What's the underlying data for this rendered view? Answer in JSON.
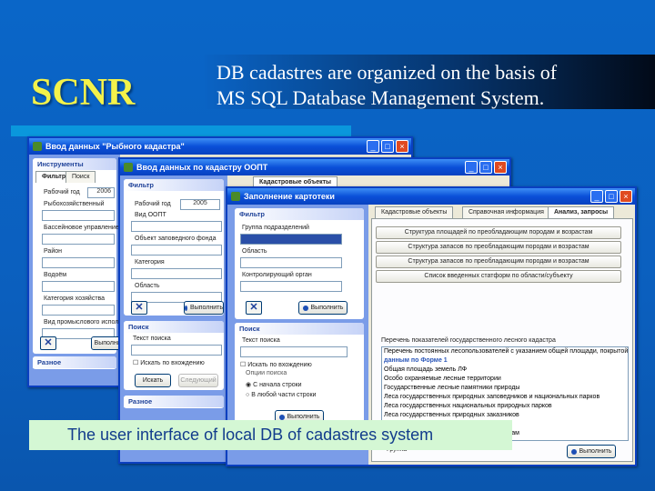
{
  "slide": {
    "logo": "SCNR",
    "subtitle_line1": "DB cadastres are organized on the basis of",
    "subtitle_line2": "MS SQL Database Management System.",
    "caption": "The user interface of local DB of cadastres system"
  },
  "win1": {
    "title": "Ввод данных \"Рыбного кадастра\"",
    "panel": "Инструменты",
    "tabs": [
      "Фильтр",
      "Поиск"
    ],
    "year_label": "Рабочий год",
    "year": "2006",
    "labels": [
      "Рыбохозяйственный",
      "Бассейновое управление",
      "Район",
      "Водоём",
      "Категория хозяйства",
      "Вид промыслового использования"
    ],
    "exec": "Выполнить",
    "misc": "Разное",
    "right_tab": "Кадастровые объекты"
  },
  "win2": {
    "title": "Ввод данных по кадастру ООПТ",
    "filter": "Фильтр",
    "year_label": "Рабочий год",
    "year": "2005",
    "labels": [
      "Вид ООПТ",
      "Объект заповедного фонда",
      "Категория",
      "Область"
    ],
    "exec": "Выполнить",
    "search": "Поиск",
    "search_text": "Текст поиска",
    "by_entry": "Искать по вхождению",
    "find": "Искать",
    "next": "Следующий",
    "misc": "Разное",
    "tab": "Кадастровые объекты"
  },
  "win3": {
    "title": "Заполнение картотеки",
    "filter": "Фильтр",
    "labels": [
      "Группа подразделений",
      "Область",
      "Контролирующий орган"
    ],
    "exec": "Выполнить",
    "search": "Поиск",
    "search_text": "Текст поиска",
    "by_entry": "Искать по вхождению",
    "options": "Опции поиска",
    "opt1": "С начала строки",
    "opt2": "В любой части строки",
    "tabs": [
      "Кадастровые объекты",
      "Справочная информация",
      "Анализ, запросы"
    ],
    "queries": [
      "Структура площадей по преобладающим породам и возрастам",
      "Структура запасов по преобладающим породам и возрастам",
      "Структура запасов по преобладающим породам и возрастам",
      "Список введенных статформ по области/субъекту"
    ],
    "group": "Перечень показателей государственного лесного кадастра",
    "list": [
      "Перечень постоянных лесопользователей с указанием общей площади, покрытой",
      "данным по Форме 1",
      "Общая площадь земель ЛФ",
      "Особо охраняемые лесные территории",
      "Государственные лесные памятники природы",
      "Леса государственных природных заповедников и национальных парков",
      "Леса государственных национальных природных парков",
      "Леса государственных природных заказников",
      "Леса государственных природных парков",
      "...",
      "Леса, отнесенные к генетическим резерватам"
    ],
    "bottom_label": "Группа"
  }
}
